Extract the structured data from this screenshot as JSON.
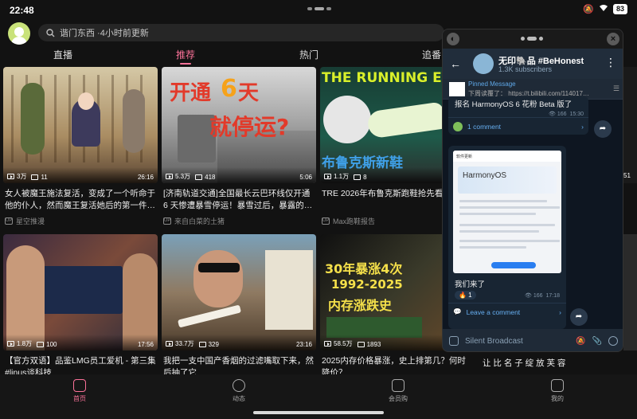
{
  "status": {
    "time": "22:48",
    "battery": "83"
  },
  "search": {
    "placeholder": "谐门东西 ·4小时前更新"
  },
  "tabs": [
    {
      "label": "直播"
    },
    {
      "label": "推荐"
    },
    {
      "label": "热门"
    },
    {
      "label": "追番"
    }
  ],
  "cards": [
    {
      "views": "3万",
      "danmaku": "11",
      "duration": "26:16",
      "title": "女人被魔王施法复活，变成了一个听命于他的仆人，然而魔王复活她后的第一件…",
      "author": "星空推漫"
    },
    {
      "views": "5.3万",
      "danmaku": "418",
      "duration": "5:06",
      "title": "[济南轨道交通]全国最长云巴环线仅开通6 天惨遭暴雪停运！暴雪过后，暴露的…",
      "author": "来自白菜的土猪",
      "thumb_text_1": "开通",
      "thumb_text_2": "6",
      "thumb_text_3": "天",
      "thumb_text_4": "就停运?"
    },
    {
      "views": "1.1万",
      "danmaku": "8",
      "duration": "",
      "title": "TRE 2026年布鲁克斯跑鞋抢先看",
      "author": "Max跑鞋报告",
      "thumb_text_1": "THE RUNNING EVENT",
      "thumb_text_2": "布鲁克斯新鞋"
    },
    {
      "views": "1.8万",
      "danmaku": "100",
      "duration": "17:56",
      "title": "【官方双语】品鉴LMG员工爱机 - 第三集 #linus谈科技",
      "author": ""
    },
    {
      "views": "33.7万",
      "danmaku": "329",
      "duration": "23:16",
      "title": "我把一支中国产香烟的过滤嘴取下来，然后抽了它",
      "author": ""
    },
    {
      "views": "58.5万",
      "danmaku": "1893",
      "duration": "",
      "title": "2025内存价格暴涨，史上排第几？何时降价？",
      "author": "",
      "thumb_text_1": "30年暴涨4次",
      "thumb_text_2": "1992-2025",
      "thumb_text_3": "内存涨跌史"
    }
  ],
  "partial_right": {
    "row1": "51",
    "row2_title": "让 比 名 子 绽 放 芙 容"
  },
  "bottomnav": [
    {
      "label": "首页"
    },
    {
      "label": "动态"
    },
    {
      "label": "会员购"
    },
    {
      "label": "我的"
    }
  ],
  "telegram": {
    "channel_name": "无印🐘品 #BeHonest",
    "subscribers": "1.3K subscribers",
    "pinned_title": "Pinned Message",
    "pinned_text": "下周读覆了：  https://t.bilibili.com/114017…",
    "msg1_text": "报名 HarmonyOS 6 花粉 Beta 版了",
    "msg1_views": "166",
    "msg1_time": "15:30",
    "msg1_comment": "1 comment",
    "shot_header": "软件更新",
    "shot_logo": "HarmonyOS",
    "msg2_text": "我们来了",
    "msg2_reaction": "🔥 1",
    "msg2_views": "166",
    "msg2_time": "17:18",
    "msg2_comment": "Leave a comment",
    "input_placeholder": "Silent Broadcast"
  }
}
